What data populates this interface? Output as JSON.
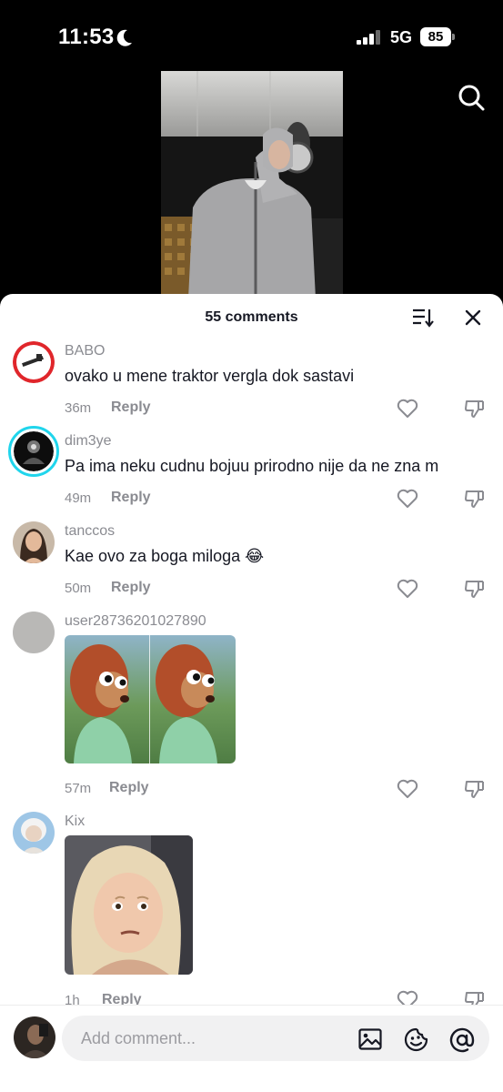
{
  "status_bar": {
    "time": "11:53",
    "network": "5G",
    "battery": "85"
  },
  "header": {
    "comment_count": "55 comments"
  },
  "comments": [
    {
      "username": "BABO",
      "text": "ovako u mene traktor vergla dok sastavi",
      "time": "36m",
      "reply": "Reply"
    },
    {
      "username": "dim3ye",
      "text": "Pa ima neku cudnu bojuu prirodno nije da ne zna m",
      "time": "49m",
      "reply": "Reply"
    },
    {
      "username": "tanccos",
      "text": "Kae ovo za boga miloga 😂",
      "time": "50m",
      "reply": "Reply"
    },
    {
      "username": "user28736201027890",
      "text": "",
      "time": "57m",
      "reply": "Reply"
    },
    {
      "username": "Kix",
      "text": "",
      "time": "1h",
      "reply": "Reply"
    }
  ],
  "composer": {
    "placeholder": "Add comment..."
  },
  "icons": {
    "search": "search-icon",
    "sort": "sort-icon",
    "close": "close-icon",
    "like": "heart-icon",
    "dislike": "thumbs-down-icon",
    "image": "image-icon",
    "emoji": "emoji-icon",
    "mention": "at-icon"
  },
  "colors": {
    "text_primary": "#161823",
    "text_secondary": "#8a8b91",
    "story_ring": "#20d5ec",
    "badge_red": "#e0262b"
  }
}
